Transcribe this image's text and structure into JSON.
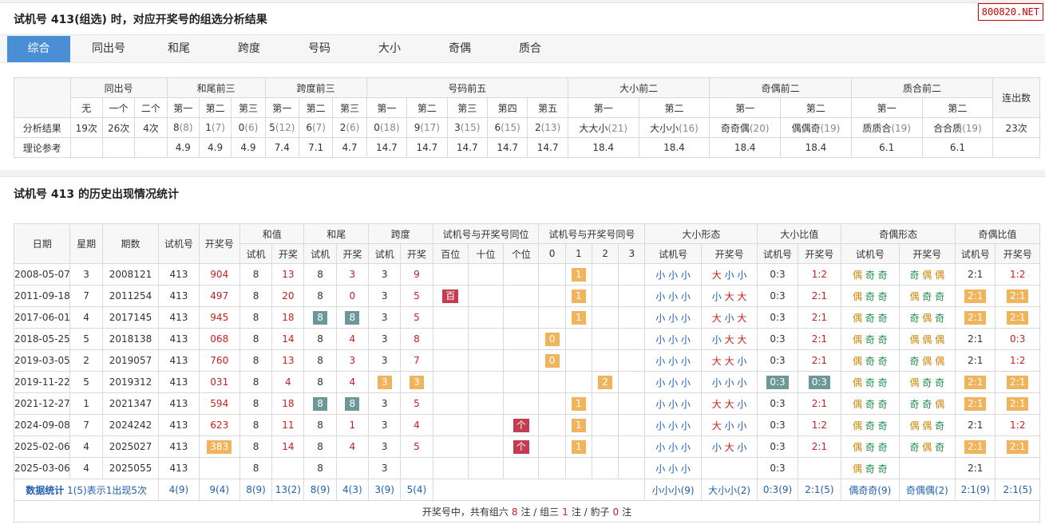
{
  "header": {
    "title": "试机号 413(组选) 时，对应开奖号的组选分析结果",
    "watermark": "800820.NET"
  },
  "tabs": [
    "综合",
    "同出号",
    "和尾",
    "跨度",
    "号码",
    "大小",
    "奇偶",
    "质合"
  ],
  "summary": {
    "groups": [
      "同出号",
      "和尾前三",
      "跨度前三",
      "号码前五",
      "大小前二",
      "奇偶前二",
      "质合前二",
      "连出数"
    ],
    "sub_headers": [
      "无",
      "一个",
      "二个",
      "第一",
      "第二",
      "第三",
      "第一",
      "第二",
      "第三",
      "第一",
      "第二",
      "第三",
      "第四",
      "第五",
      "第一",
      "第二",
      "第一",
      "第二",
      "第一",
      "第二"
    ],
    "row_result_label": "分析结果",
    "row_ref_label": "理论参考",
    "result": [
      [
        "19次",
        ""
      ],
      [
        "26次",
        ""
      ],
      [
        "4次",
        ""
      ],
      [
        "8",
        "(8)"
      ],
      [
        "1",
        "(7)"
      ],
      [
        "0",
        "(6)"
      ],
      [
        "5",
        "(12)"
      ],
      [
        "6",
        "(7)"
      ],
      [
        "2",
        "(6)"
      ],
      [
        "0",
        "(18)"
      ],
      [
        "9",
        "(17)"
      ],
      [
        "3",
        "(15)"
      ],
      [
        "6",
        "(15)"
      ],
      [
        "2",
        "(13)"
      ],
      [
        "大大小",
        "(21)"
      ],
      [
        "大小小",
        "(16)"
      ],
      [
        "奇奇偶",
        "(20)"
      ],
      [
        "偶偶奇",
        "(19)"
      ],
      [
        "质质合",
        "(19)"
      ],
      [
        "合合质",
        "(19)"
      ],
      [
        "23次",
        ""
      ]
    ],
    "reference": [
      "",
      "",
      "",
      "4.9",
      "4.9",
      "4.9",
      "7.4",
      "7.1",
      "4.7",
      "14.7",
      "14.7",
      "14.7",
      "14.7",
      "14.7",
      "18.4",
      "18.4",
      "18.4",
      "18.4",
      "6.1",
      "6.1",
      ""
    ]
  },
  "history": {
    "title": "试机号 413 的历史出现情况统计",
    "head_top": [
      "日期",
      "星期",
      "期数",
      "试机号",
      "开奖号",
      "和值",
      "和尾",
      "跨度",
      "试机号与开奖号同位",
      "试机号与开奖号同号",
      "大小形态",
      "大小比值",
      "奇偶形态",
      "奇偶比值"
    ],
    "head_sub": [
      "试机",
      "开奖",
      "试机",
      "开奖",
      "试机",
      "开奖",
      "百位",
      "十位",
      "个位",
      "0",
      "1",
      "2",
      "3",
      "试机号",
      "开奖号",
      "试机号",
      "开奖号",
      "试机号",
      "开奖号",
      "试机号",
      "开奖号"
    ],
    "rows": [
      {
        "date": "2008-05-07",
        "week": "3",
        "issue": "2008121",
        "try": "413",
        "draw": "904",
        "hs": "8",
        "hd": "13",
        "ws": "8",
        "wd": "3",
        "ks": "3",
        "kd": "9",
        "pos": [
          "",
          "",
          ""
        ],
        "same": [
          "",
          "1",
          "",
          ""
        ],
        "dx_s": "小 小 小",
        "dx_d": "大 小 小",
        "dxr_s": "0:3",
        "dxr_d": "1:2",
        "jo_s": "偶 奇 奇",
        "jo_d": "奇 偶 偶",
        "jor_s": "2:1",
        "jor_d": "1:2"
      },
      {
        "date": "2011-09-18",
        "week": "7",
        "issue": "2011254",
        "try": "413",
        "draw": "497",
        "hs": "8",
        "hd": "20",
        "ws": "8",
        "wd": "0",
        "ks": "3",
        "kd": "5",
        "pos": [
          "百",
          "",
          ""
        ],
        "same": [
          "",
          "1",
          "",
          ""
        ],
        "dx_s": "小 小 小",
        "dx_d": "小 大 大",
        "dxr_s": "0:3",
        "dxr_d": "2:1",
        "jo_s": "偶 奇 奇",
        "jo_d": "偶 奇 奇",
        "jor_s": "2:1",
        "jor_d": "2:1"
      },
      {
        "date": "2017-06-01",
        "week": "4",
        "issue": "2017145",
        "try": "413",
        "draw": "945",
        "hs": "8",
        "hd": "18",
        "ws": "8",
        "wd": "8",
        "ks": "3",
        "kd": "5",
        "pos": [
          "",
          "",
          ""
        ],
        "same": [
          "",
          "1",
          "",
          ""
        ],
        "dx_s": "小 小 小",
        "dx_d": "大 小 大",
        "dxr_s": "0:3",
        "dxr_d": "2:1",
        "jo_s": "偶 奇 奇",
        "jo_d": "奇 偶 奇",
        "jor_s": "2:1",
        "jor_d": "2:1"
      },
      {
        "date": "2018-05-25",
        "week": "5",
        "issue": "2018138",
        "try": "413",
        "draw": "068",
        "hs": "8",
        "hd": "14",
        "ws": "8",
        "wd": "4",
        "ks": "3",
        "kd": "8",
        "pos": [
          "",
          "",
          ""
        ],
        "same": [
          "0",
          "",
          "",
          ""
        ],
        "dx_s": "小 小 小",
        "dx_d": "小 大 大",
        "dxr_s": "0:3",
        "dxr_d": "2:1",
        "jo_s": "偶 奇 奇",
        "jo_d": "偶 偶 偶",
        "jor_s": "2:1",
        "jor_d": "0:3"
      },
      {
        "date": "2019-03-05",
        "week": "2",
        "issue": "2019057",
        "try": "413",
        "draw": "760",
        "hs": "8",
        "hd": "13",
        "ws": "8",
        "wd": "3",
        "ks": "3",
        "kd": "7",
        "pos": [
          "",
          "",
          ""
        ],
        "same": [
          "0",
          "",
          "",
          ""
        ],
        "dx_s": "小 小 小",
        "dx_d": "大 大 小",
        "dxr_s": "0:3",
        "dxr_d": "2:1",
        "jo_s": "偶 奇 奇",
        "jo_d": "奇 偶 偶",
        "jor_s": "2:1",
        "jor_d": "1:2"
      },
      {
        "date": "2019-11-22",
        "week": "5",
        "issue": "2019312",
        "try": "413",
        "draw": "031",
        "hs": "8",
        "hd": "4",
        "ws": "8",
        "wd": "4",
        "ks": "3",
        "kd": "3",
        "pos": [
          "",
          "",
          ""
        ],
        "same": [
          "",
          "",
          "2",
          ""
        ],
        "dx_s": "小 小 小",
        "dx_d": "小 小 小",
        "dxr_s": "0:3",
        "dxr_d": "0:3",
        "jo_s": "偶 奇 奇",
        "jo_d": "偶 奇 奇",
        "jor_s": "2:1",
        "jor_d": "2:1"
      },
      {
        "date": "2021-12-27",
        "week": "1",
        "issue": "2021347",
        "try": "413",
        "draw": "594",
        "hs": "8",
        "hd": "18",
        "ws": "8",
        "wd": "8",
        "ks": "3",
        "kd": "5",
        "pos": [
          "",
          "",
          ""
        ],
        "same": [
          "",
          "1",
          "",
          ""
        ],
        "dx_s": "小 小 小",
        "dx_d": "大 大 小",
        "dxr_s": "0:3",
        "dxr_d": "2:1",
        "jo_s": "偶 奇 奇",
        "jo_d": "奇 奇 偶",
        "jor_s": "2:1",
        "jor_d": "2:1"
      },
      {
        "date": "2024-09-08",
        "week": "7",
        "issue": "2024242",
        "try": "413",
        "draw": "623",
        "hs": "8",
        "hd": "11",
        "ws": "8",
        "wd": "1",
        "ks": "3",
        "kd": "4",
        "pos": [
          "",
          "",
          "个"
        ],
        "same": [
          "",
          "1",
          "",
          ""
        ],
        "dx_s": "小 小 小",
        "dx_d": "大 小 小",
        "dxr_s": "0:3",
        "dxr_d": "1:2",
        "jo_s": "偶 奇 奇",
        "jo_d": "偶 偶 奇",
        "jor_s": "2:1",
        "jor_d": "1:2"
      },
      {
        "date": "2025-02-06",
        "week": "4",
        "issue": "2025027",
        "try": "413",
        "draw": "383",
        "hs": "8",
        "hd": "14",
        "ws": "8",
        "wd": "4",
        "ks": "3",
        "kd": "5",
        "pos": [
          "",
          "",
          "个"
        ],
        "same": [
          "",
          "1",
          "",
          ""
        ],
        "dx_s": "小 小 小",
        "dx_d": "小 大 小",
        "dxr_s": "0:3",
        "dxr_d": "2:1",
        "jo_s": "偶 奇 奇",
        "jo_d": "奇 偶 奇",
        "jor_s": "2:1",
        "jor_d": "2:1"
      },
      {
        "date": "2025-03-06",
        "week": "4",
        "issue": "2025055",
        "try": "413",
        "draw": "",
        "hs": "8",
        "hd": "",
        "ws": "8",
        "wd": "",
        "ks": "3",
        "kd": "",
        "pos": [
          "",
          "",
          ""
        ],
        "same": [
          "",
          "",
          "",
          ""
        ],
        "dx_s": "小 小 小",
        "dx_d": "",
        "dxr_s": "0:3",
        "dxr_d": "",
        "jo_s": "偶 奇 奇",
        "jo_d": "",
        "jor_s": "2:1",
        "jor_d": ""
      }
    ],
    "stats": {
      "label": "数据统计",
      "note": "1(5)表示1出现5次",
      "try": "4(9)",
      "draw": "9(4)",
      "hs": "8(9)",
      "hd": "13(2)",
      "ws": "8(9)",
      "wd": "4(3)",
      "ks": "3(9)",
      "kd": "5(4)",
      "dx_s": "小小小(9)",
      "dx_d": "大小小(2)",
      "dxr_s": "0:3(9)",
      "dxr_d": "2:1(5)",
      "jo_s": "偶奇奇(9)",
      "jo_d": "奇偶偶(2)",
      "jor_s": "2:1(9)",
      "jor_d": "2:1(5)"
    },
    "footer": {
      "prefix": "开奖号中，共有组六",
      "g6": "8",
      "mid1": "注 / 组三",
      "g3": "1",
      "mid2": "注 / 豹子",
      "bz": "0",
      "suffix": "注"
    }
  }
}
